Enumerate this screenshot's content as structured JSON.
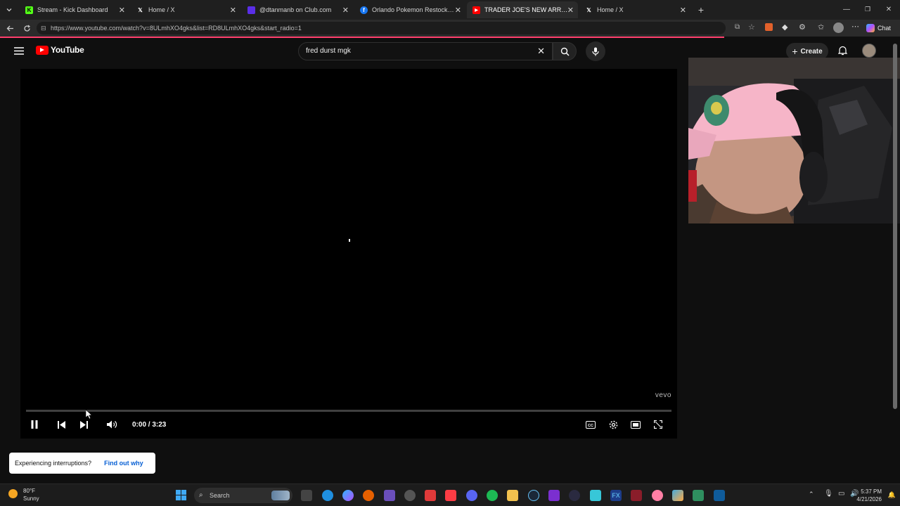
{
  "browser": {
    "tabs": [
      {
        "title": "Stream - Kick Dashboard",
        "active": false
      },
      {
        "title": "Home / X",
        "active": false
      },
      {
        "title": "@dtanmanb on Club.com",
        "active": false
      },
      {
        "title": "Orlando Pokemon Restocks | Face",
        "active": false
      },
      {
        "title": "TRADER JOE'S NEW ARRIVALS & C",
        "active": true
      },
      {
        "title": "Home / X",
        "active": false
      }
    ],
    "url": "https://www.youtube.com/watch?v=8ULmhXO4gks&list=RD8ULmhXO4gks&start_radio=1",
    "chat_label": "Chat"
  },
  "youtube": {
    "logo_text": "YouTube",
    "search_value": "fred durst mgk",
    "create_label": "Create"
  },
  "player": {
    "time": "0:00 / 3:23",
    "progress": 0.0,
    "watermark": "vevo"
  },
  "toast": {
    "message": "Experiencing interruptions?",
    "link": "Find out why"
  },
  "taskbar": {
    "weather_temp": "80°F",
    "weather_cond": "Sunny",
    "search_placeholder": "Search",
    "time": "5:37 PM",
    "date": "4/21/2026"
  },
  "colors": {
    "youtube_red": "#ff0000",
    "link_blue": "#065fd4",
    "loading_bar": "#ff3e6c"
  }
}
